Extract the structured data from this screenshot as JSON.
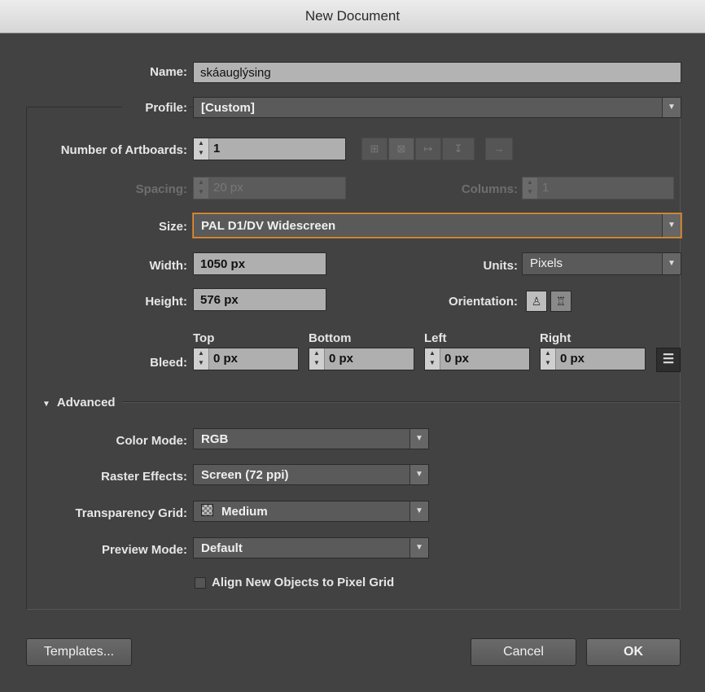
{
  "title": "New Document",
  "name": {
    "label": "Name:",
    "value": "skáauglýsing"
  },
  "profile": {
    "label": "Profile:",
    "value": "[Custom]"
  },
  "artboards": {
    "label": "Number of Artboards:",
    "value": "1",
    "arrange_icons": [
      "grid-by-row-icon",
      "grid-by-column-icon",
      "arrange-by-row-icon",
      "arrange-by-column-icon",
      "right-to-left-icon"
    ]
  },
  "spacing": {
    "label": "Spacing:",
    "value": "20 px"
  },
  "columns": {
    "label": "Columns:",
    "value": "1"
  },
  "size": {
    "label": "Size:",
    "value": "PAL D1/DV Widescreen"
  },
  "width": {
    "label": "Width:",
    "value": "1050 px"
  },
  "height": {
    "label": "Height:",
    "value": "576 px"
  },
  "units": {
    "label": "Units:",
    "value": "Pixels"
  },
  "orientation": {
    "label": "Orientation:",
    "portrait_icon": "portrait-icon",
    "landscape_icon": "landscape-icon"
  },
  "bleed": {
    "label": "Bleed:",
    "top": {
      "label": "Top",
      "value": "0 px"
    },
    "bottom": {
      "label": "Bottom",
      "value": "0 px"
    },
    "left": {
      "label": "Left",
      "value": "0 px"
    },
    "right": {
      "label": "Right",
      "value": "0 px"
    },
    "link_icon": "link-icon"
  },
  "advanced": {
    "label": "Advanced",
    "color_mode": {
      "label": "Color Mode:",
      "value": "RGB"
    },
    "raster_effects": {
      "label": "Raster Effects:",
      "value": "Screen (72 ppi)"
    },
    "transparency_grid": {
      "label": "Transparency Grid:",
      "value": "Medium"
    },
    "preview_mode": {
      "label": "Preview Mode:",
      "value": "Default"
    },
    "align_pixel_grid": {
      "label": "Align New Objects to Pixel Grid",
      "checked": false
    }
  },
  "buttons": {
    "templates": "Templates...",
    "cancel": "Cancel",
    "ok": "OK"
  },
  "colors": {
    "focus_ring": "#e09332",
    "dialog_bg": "#424242",
    "field_bg": "#afafaf"
  }
}
